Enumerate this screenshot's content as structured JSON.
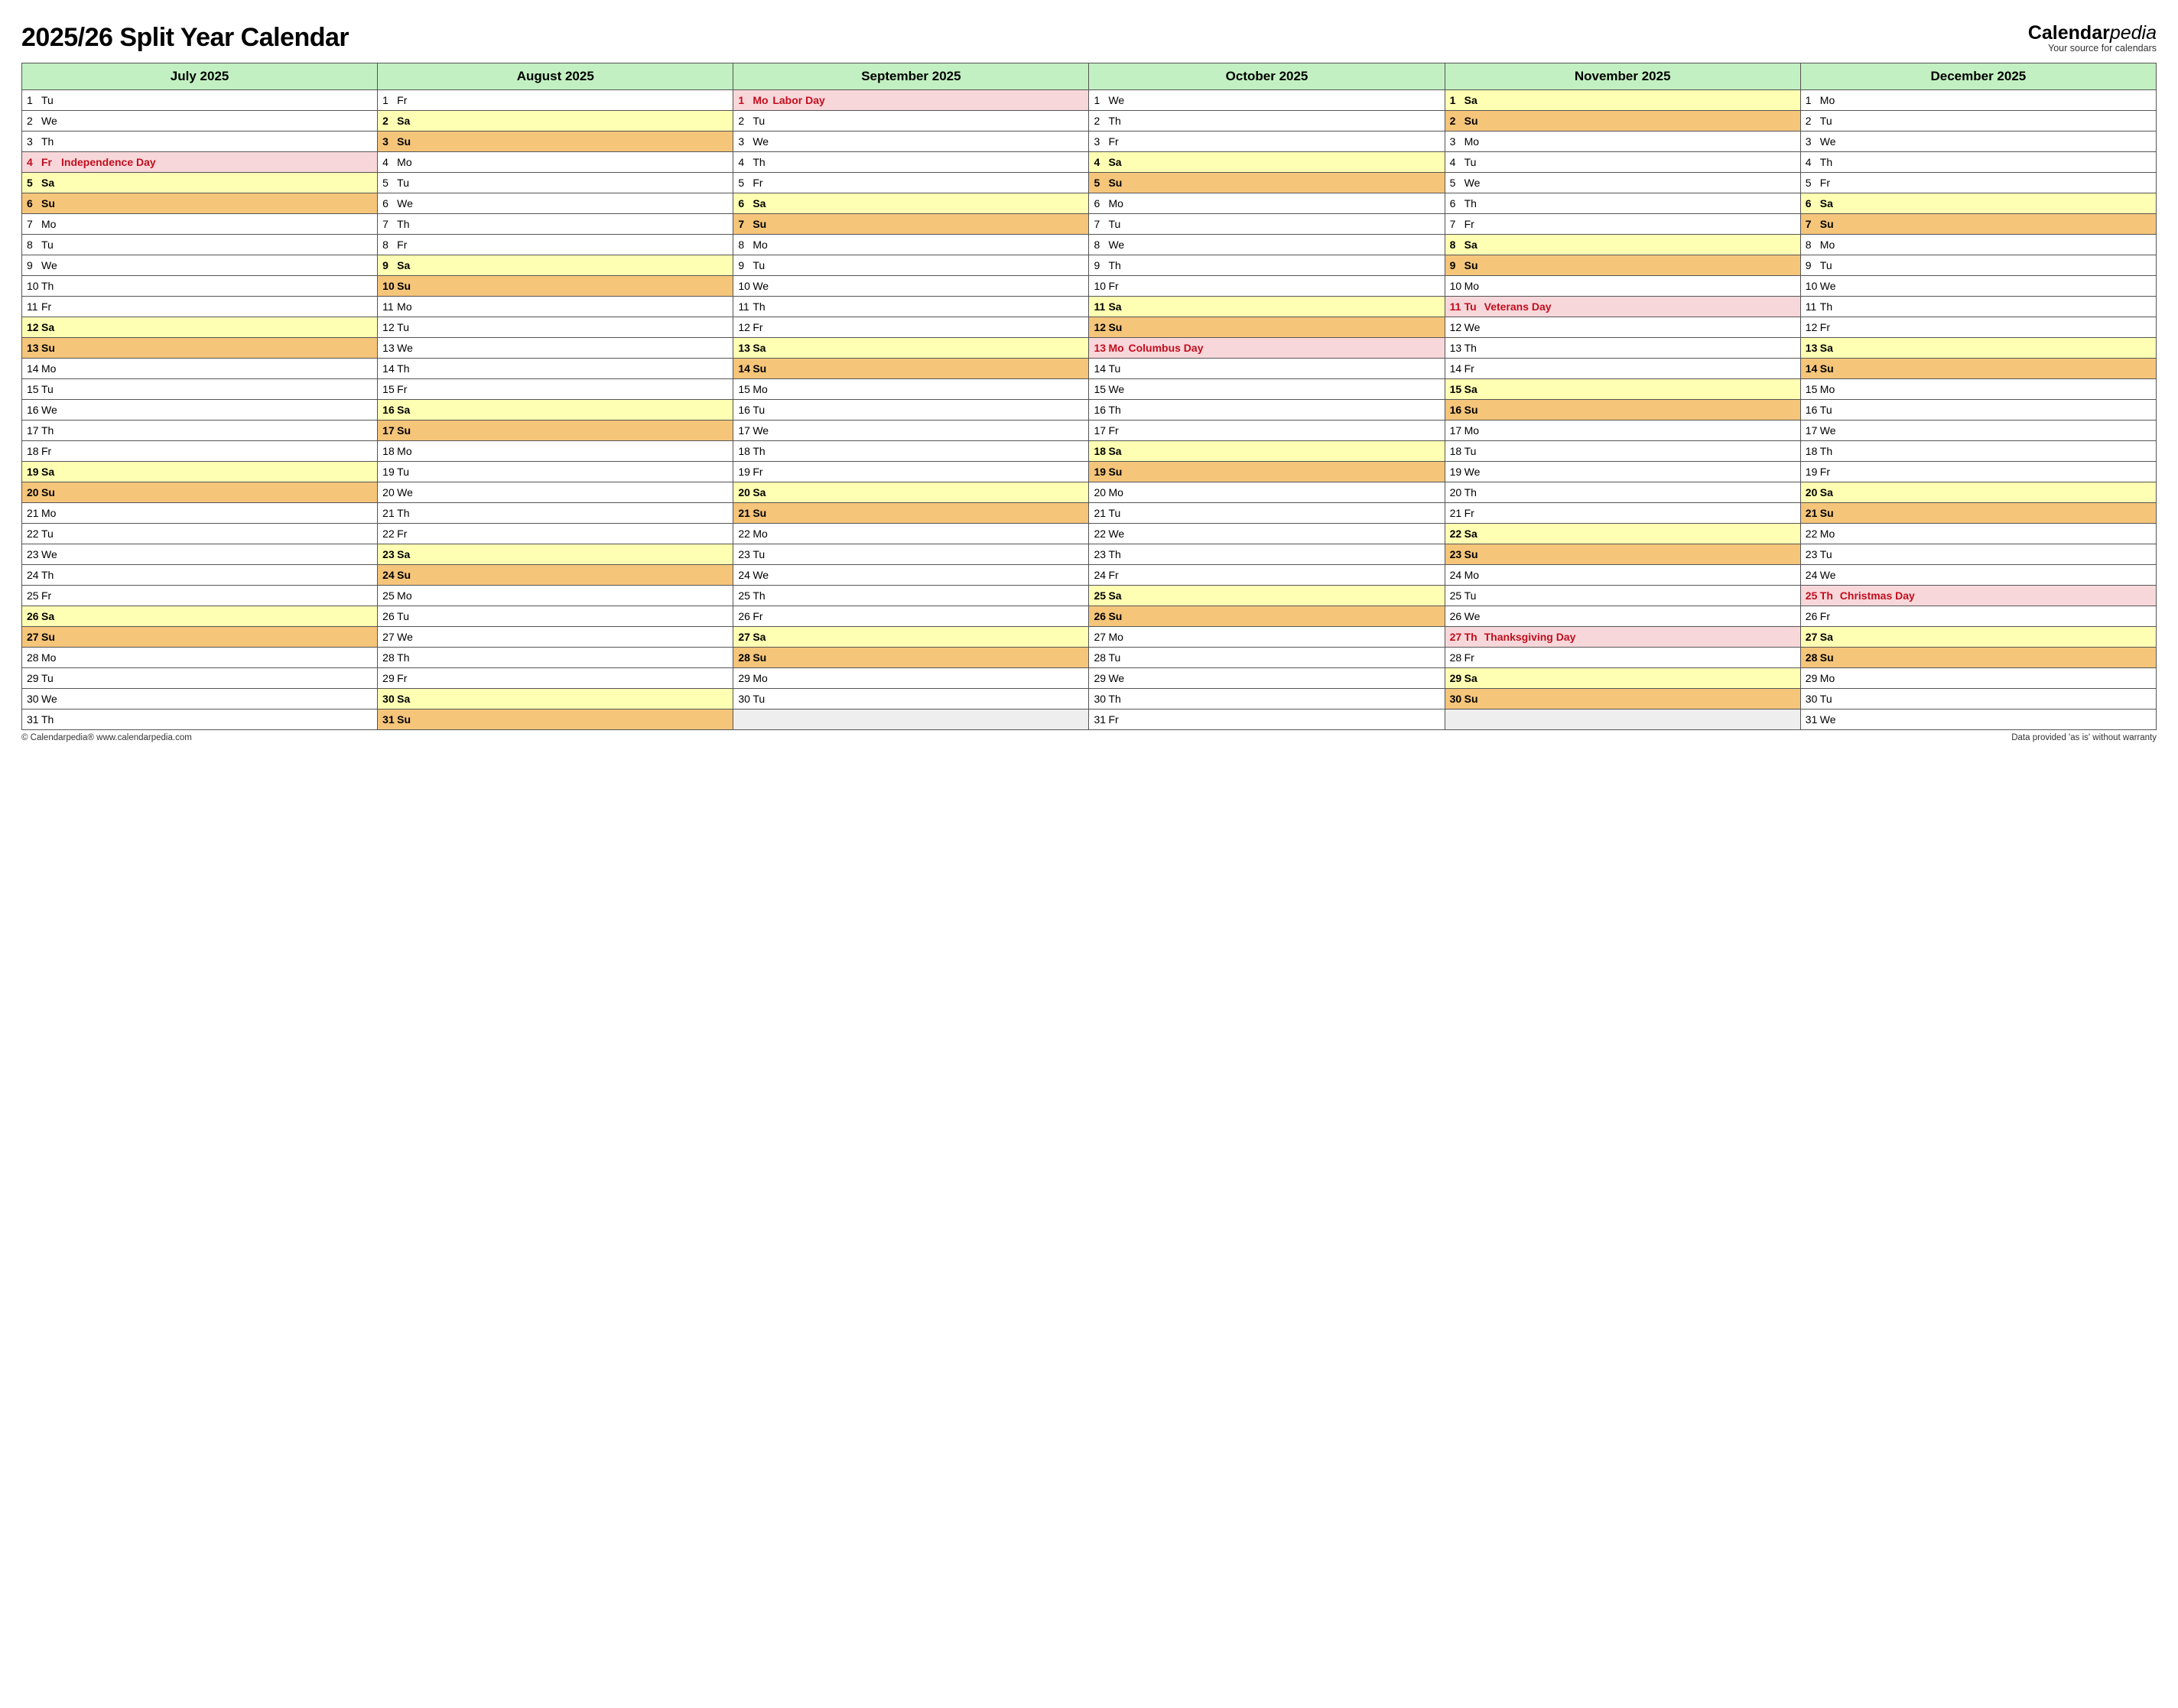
{
  "title": "2025/26 Split Year Calendar",
  "brand": {
    "a": "Calendar",
    "b": "pedia",
    "tag": "Your source for calendars"
  },
  "footer": {
    "left": "© Calendarpedia®   www.calendarpedia.com",
    "right": "Data provided 'as is' without warranty"
  },
  "months": [
    {
      "name": "July 2025",
      "days": [
        {
          "n": 1,
          "d": "Tu"
        },
        {
          "n": 2,
          "d": "We"
        },
        {
          "n": 3,
          "d": "Th"
        },
        {
          "n": 4,
          "d": "Fr",
          "ev": "Independence Day",
          "hol": true
        },
        {
          "n": 5,
          "d": "Sa",
          "sat": true
        },
        {
          "n": 6,
          "d": "Su",
          "sun": true
        },
        {
          "n": 7,
          "d": "Mo"
        },
        {
          "n": 8,
          "d": "Tu"
        },
        {
          "n": 9,
          "d": "We"
        },
        {
          "n": 10,
          "d": "Th"
        },
        {
          "n": 11,
          "d": "Fr"
        },
        {
          "n": 12,
          "d": "Sa",
          "sat": true
        },
        {
          "n": 13,
          "d": "Su",
          "sun": true
        },
        {
          "n": 14,
          "d": "Mo"
        },
        {
          "n": 15,
          "d": "Tu"
        },
        {
          "n": 16,
          "d": "We"
        },
        {
          "n": 17,
          "d": "Th"
        },
        {
          "n": 18,
          "d": "Fr"
        },
        {
          "n": 19,
          "d": "Sa",
          "sat": true
        },
        {
          "n": 20,
          "d": "Su",
          "sun": true
        },
        {
          "n": 21,
          "d": "Mo"
        },
        {
          "n": 22,
          "d": "Tu"
        },
        {
          "n": 23,
          "d": "We"
        },
        {
          "n": 24,
          "d": "Th"
        },
        {
          "n": 25,
          "d": "Fr"
        },
        {
          "n": 26,
          "d": "Sa",
          "sat": true
        },
        {
          "n": 27,
          "d": "Su",
          "sun": true
        },
        {
          "n": 28,
          "d": "Mo"
        },
        {
          "n": 29,
          "d": "Tu"
        },
        {
          "n": 30,
          "d": "We"
        },
        {
          "n": 31,
          "d": "Th"
        }
      ]
    },
    {
      "name": "August 2025",
      "days": [
        {
          "n": 1,
          "d": "Fr"
        },
        {
          "n": 2,
          "d": "Sa",
          "sat": true
        },
        {
          "n": 3,
          "d": "Su",
          "sun": true
        },
        {
          "n": 4,
          "d": "Mo"
        },
        {
          "n": 5,
          "d": "Tu"
        },
        {
          "n": 6,
          "d": "We"
        },
        {
          "n": 7,
          "d": "Th"
        },
        {
          "n": 8,
          "d": "Fr"
        },
        {
          "n": 9,
          "d": "Sa",
          "sat": true
        },
        {
          "n": 10,
          "d": "Su",
          "sun": true
        },
        {
          "n": 11,
          "d": "Mo"
        },
        {
          "n": 12,
          "d": "Tu"
        },
        {
          "n": 13,
          "d": "We"
        },
        {
          "n": 14,
          "d": "Th"
        },
        {
          "n": 15,
          "d": "Fr"
        },
        {
          "n": 16,
          "d": "Sa",
          "sat": true
        },
        {
          "n": 17,
          "d": "Su",
          "sun": true
        },
        {
          "n": 18,
          "d": "Mo"
        },
        {
          "n": 19,
          "d": "Tu"
        },
        {
          "n": 20,
          "d": "We"
        },
        {
          "n": 21,
          "d": "Th"
        },
        {
          "n": 22,
          "d": "Fr"
        },
        {
          "n": 23,
          "d": "Sa",
          "sat": true
        },
        {
          "n": 24,
          "d": "Su",
          "sun": true
        },
        {
          "n": 25,
          "d": "Mo"
        },
        {
          "n": 26,
          "d": "Tu"
        },
        {
          "n": 27,
          "d": "We"
        },
        {
          "n": 28,
          "d": "Th"
        },
        {
          "n": 29,
          "d": "Fr"
        },
        {
          "n": 30,
          "d": "Sa",
          "sat": true
        },
        {
          "n": 31,
          "d": "Su",
          "sun": true
        }
      ]
    },
    {
      "name": "September 2025",
      "days": [
        {
          "n": 1,
          "d": "Mo",
          "ev": "Labor Day",
          "hol": true
        },
        {
          "n": 2,
          "d": "Tu"
        },
        {
          "n": 3,
          "d": "We"
        },
        {
          "n": 4,
          "d": "Th"
        },
        {
          "n": 5,
          "d": "Fr"
        },
        {
          "n": 6,
          "d": "Sa",
          "sat": true
        },
        {
          "n": 7,
          "d": "Su",
          "sun": true
        },
        {
          "n": 8,
          "d": "Mo"
        },
        {
          "n": 9,
          "d": "Tu"
        },
        {
          "n": 10,
          "d": "We"
        },
        {
          "n": 11,
          "d": "Th"
        },
        {
          "n": 12,
          "d": "Fr"
        },
        {
          "n": 13,
          "d": "Sa",
          "sat": true
        },
        {
          "n": 14,
          "d": "Su",
          "sun": true
        },
        {
          "n": 15,
          "d": "Mo"
        },
        {
          "n": 16,
          "d": "Tu"
        },
        {
          "n": 17,
          "d": "We"
        },
        {
          "n": 18,
          "d": "Th"
        },
        {
          "n": 19,
          "d": "Fr"
        },
        {
          "n": 20,
          "d": "Sa",
          "sat": true
        },
        {
          "n": 21,
          "d": "Su",
          "sun": true
        },
        {
          "n": 22,
          "d": "Mo"
        },
        {
          "n": 23,
          "d": "Tu"
        },
        {
          "n": 24,
          "d": "We"
        },
        {
          "n": 25,
          "d": "Th"
        },
        {
          "n": 26,
          "d": "Fr"
        },
        {
          "n": 27,
          "d": "Sa",
          "sat": true
        },
        {
          "n": 28,
          "d": "Su",
          "sun": true
        },
        {
          "n": 29,
          "d": "Mo"
        },
        {
          "n": 30,
          "d": "Tu"
        }
      ]
    },
    {
      "name": "October 2025",
      "days": [
        {
          "n": 1,
          "d": "We"
        },
        {
          "n": 2,
          "d": "Th"
        },
        {
          "n": 3,
          "d": "Fr"
        },
        {
          "n": 4,
          "d": "Sa",
          "sat": true
        },
        {
          "n": 5,
          "d": "Su",
          "sun": true
        },
        {
          "n": 6,
          "d": "Mo"
        },
        {
          "n": 7,
          "d": "Tu"
        },
        {
          "n": 8,
          "d": "We"
        },
        {
          "n": 9,
          "d": "Th"
        },
        {
          "n": 10,
          "d": "Fr"
        },
        {
          "n": 11,
          "d": "Sa",
          "sat": true
        },
        {
          "n": 12,
          "d": "Su",
          "sun": true
        },
        {
          "n": 13,
          "d": "Mo",
          "ev": "Columbus Day",
          "hol": true
        },
        {
          "n": 14,
          "d": "Tu"
        },
        {
          "n": 15,
          "d": "We"
        },
        {
          "n": 16,
          "d": "Th"
        },
        {
          "n": 17,
          "d": "Fr"
        },
        {
          "n": 18,
          "d": "Sa",
          "sat": true
        },
        {
          "n": 19,
          "d": "Su",
          "sun": true
        },
        {
          "n": 20,
          "d": "Mo"
        },
        {
          "n": 21,
          "d": "Tu"
        },
        {
          "n": 22,
          "d": "We"
        },
        {
          "n": 23,
          "d": "Th"
        },
        {
          "n": 24,
          "d": "Fr"
        },
        {
          "n": 25,
          "d": "Sa",
          "sat": true
        },
        {
          "n": 26,
          "d": "Su",
          "sun": true
        },
        {
          "n": 27,
          "d": "Mo"
        },
        {
          "n": 28,
          "d": "Tu"
        },
        {
          "n": 29,
          "d": "We"
        },
        {
          "n": 30,
          "d": "Th"
        },
        {
          "n": 31,
          "d": "Fr"
        }
      ]
    },
    {
      "name": "November 2025",
      "days": [
        {
          "n": 1,
          "d": "Sa",
          "sat": true
        },
        {
          "n": 2,
          "d": "Su",
          "sun": true
        },
        {
          "n": 3,
          "d": "Mo"
        },
        {
          "n": 4,
          "d": "Tu"
        },
        {
          "n": 5,
          "d": "We"
        },
        {
          "n": 6,
          "d": "Th"
        },
        {
          "n": 7,
          "d": "Fr"
        },
        {
          "n": 8,
          "d": "Sa",
          "sat": true
        },
        {
          "n": 9,
          "d": "Su",
          "sun": true
        },
        {
          "n": 10,
          "d": "Mo"
        },
        {
          "n": 11,
          "d": "Tu",
          "ev": "Veterans Day",
          "hol": true
        },
        {
          "n": 12,
          "d": "We"
        },
        {
          "n": 13,
          "d": "Th"
        },
        {
          "n": 14,
          "d": "Fr"
        },
        {
          "n": 15,
          "d": "Sa",
          "sat": true
        },
        {
          "n": 16,
          "d": "Su",
          "sun": true
        },
        {
          "n": 17,
          "d": "Mo"
        },
        {
          "n": 18,
          "d": "Tu"
        },
        {
          "n": 19,
          "d": "We"
        },
        {
          "n": 20,
          "d": "Th"
        },
        {
          "n": 21,
          "d": "Fr"
        },
        {
          "n": 22,
          "d": "Sa",
          "sat": true
        },
        {
          "n": 23,
          "d": "Su",
          "sun": true
        },
        {
          "n": 24,
          "d": "Mo"
        },
        {
          "n": 25,
          "d": "Tu"
        },
        {
          "n": 26,
          "d": "We"
        },
        {
          "n": 27,
          "d": "Th",
          "ev": "Thanksgiving Day",
          "hol": true
        },
        {
          "n": 28,
          "d": "Fr"
        },
        {
          "n": 29,
          "d": "Sa",
          "sat": true
        },
        {
          "n": 30,
          "d": "Su",
          "sun": true
        }
      ]
    },
    {
      "name": "December 2025",
      "days": [
        {
          "n": 1,
          "d": "Mo"
        },
        {
          "n": 2,
          "d": "Tu"
        },
        {
          "n": 3,
          "d": "We"
        },
        {
          "n": 4,
          "d": "Th"
        },
        {
          "n": 5,
          "d": "Fr"
        },
        {
          "n": 6,
          "d": "Sa",
          "sat": true
        },
        {
          "n": 7,
          "d": "Su",
          "sun": true
        },
        {
          "n": 8,
          "d": "Mo"
        },
        {
          "n": 9,
          "d": "Tu"
        },
        {
          "n": 10,
          "d": "We"
        },
        {
          "n": 11,
          "d": "Th"
        },
        {
          "n": 12,
          "d": "Fr"
        },
        {
          "n": 13,
          "d": "Sa",
          "sat": true
        },
        {
          "n": 14,
          "d": "Su",
          "sun": true
        },
        {
          "n": 15,
          "d": "Mo"
        },
        {
          "n": 16,
          "d": "Tu"
        },
        {
          "n": 17,
          "d": "We"
        },
        {
          "n": 18,
          "d": "Th"
        },
        {
          "n": 19,
          "d": "Fr"
        },
        {
          "n": 20,
          "d": "Sa",
          "sat": true
        },
        {
          "n": 21,
          "d": "Su",
          "sun": true
        },
        {
          "n": 22,
          "d": "Mo"
        },
        {
          "n": 23,
          "d": "Tu"
        },
        {
          "n": 24,
          "d": "We"
        },
        {
          "n": 25,
          "d": "Th",
          "ev": "Christmas Day",
          "hol": true
        },
        {
          "n": 26,
          "d": "Fr"
        },
        {
          "n": 27,
          "d": "Sa",
          "sat": true
        },
        {
          "n": 28,
          "d": "Su",
          "sun": true
        },
        {
          "n": 29,
          "d": "Mo"
        },
        {
          "n": 30,
          "d": "Tu"
        },
        {
          "n": 31,
          "d": "We"
        }
      ]
    }
  ]
}
